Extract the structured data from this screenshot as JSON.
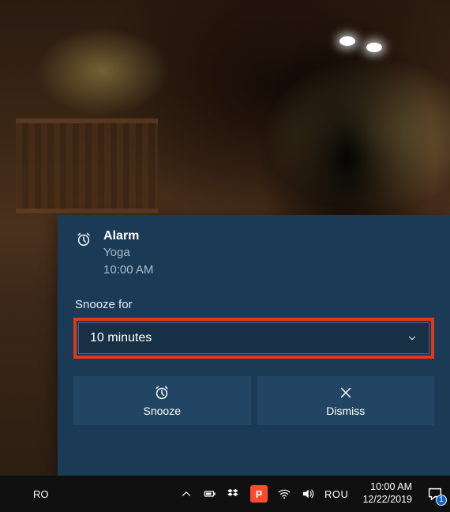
{
  "notification": {
    "title": "Alarm",
    "subtitle": "Yoga",
    "time": "10:00 AM",
    "snooze_label": "Snooze for",
    "snooze_selected": "10 minutes",
    "actions": {
      "snooze": "Snooze",
      "dismiss": "Dismiss"
    }
  },
  "taskbar": {
    "ime_lang": "RO",
    "keyboard_lang": "ROU",
    "clock_time": "10:00 AM",
    "clock_date": "12/22/2019",
    "action_center_badge": "1"
  }
}
